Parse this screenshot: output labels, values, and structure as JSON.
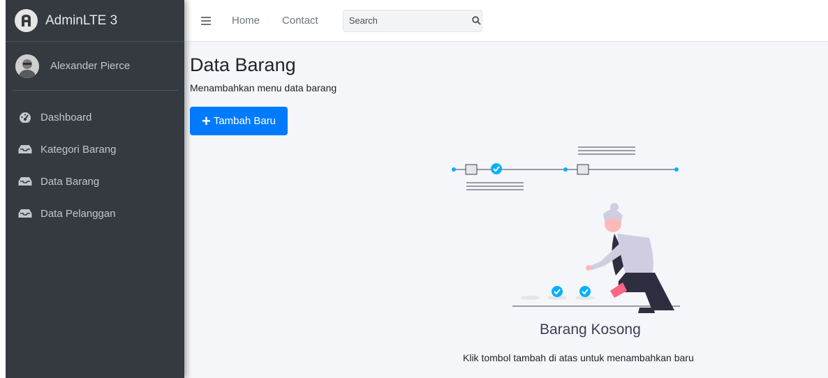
{
  "brand": {
    "name": "AdminLTE 3"
  },
  "user": {
    "name": "Alexander Pierce"
  },
  "sidebar": {
    "items": [
      {
        "label": "Dashboard",
        "icon": "tachometer-icon"
      },
      {
        "label": "Kategori Barang",
        "icon": "inbox-icon"
      },
      {
        "label": "Data Barang",
        "icon": "inbox-icon"
      },
      {
        "label": "Data Pelanggan",
        "icon": "inbox-icon"
      }
    ]
  },
  "navbar": {
    "links": [
      "Home",
      "Contact"
    ],
    "search": {
      "placeholder": "Search"
    }
  },
  "page": {
    "title": "Data Barang",
    "subtitle": "Menambahkan menu data barang",
    "add_button": "Tambah Baru"
  },
  "empty_state": {
    "title": "Barang Kosong",
    "message": "Klik tombol tambah di atas untuk menambahkan baru"
  },
  "colors": {
    "sidebar_bg": "#343a40",
    "primary": "#007bff",
    "accent": "#00b0ff",
    "content_bg": "#f4f6f9"
  }
}
